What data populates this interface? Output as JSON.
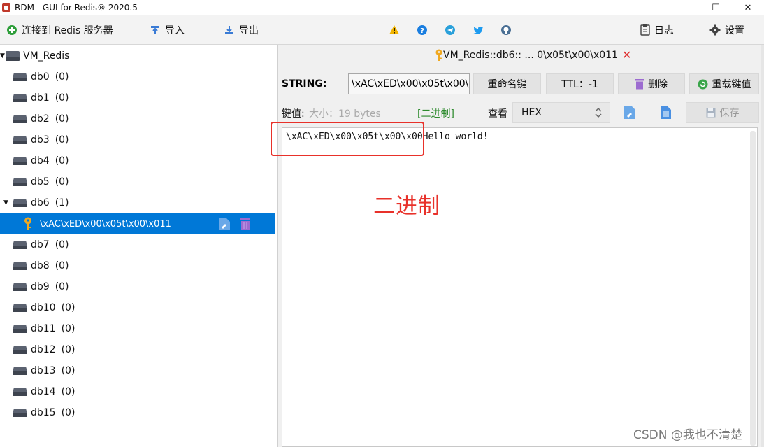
{
  "window": {
    "title": "RDM - GUI for Redis® 2020.5",
    "controls": {
      "minimize": "—",
      "maximize": "☐",
      "close": "✕"
    }
  },
  "toolbar": {
    "connect_label": "连接到 Redis 服务器",
    "import_label": "导入",
    "export_label": "导出",
    "log_label": "日志",
    "settings_label": "设置",
    "icons": [
      "warning-icon",
      "help-icon",
      "telegram-icon",
      "twitter-icon",
      "github-icon"
    ]
  },
  "tree": {
    "server": "VM_Redis",
    "databases": [
      {
        "name": "db0",
        "count": "(0)"
      },
      {
        "name": "db1",
        "count": "(0)"
      },
      {
        "name": "db2",
        "count": "(0)"
      },
      {
        "name": "db3",
        "count": "(0)"
      },
      {
        "name": "db4",
        "count": "(0)"
      },
      {
        "name": "db5",
        "count": "(0)"
      },
      {
        "name": "db6",
        "count": "(1)"
      },
      {
        "name": "db7",
        "count": "(0)"
      },
      {
        "name": "db8",
        "count": "(0)"
      },
      {
        "name": "db9",
        "count": "(0)"
      },
      {
        "name": "db10",
        "count": "(0)"
      },
      {
        "name": "db11",
        "count": "(0)"
      },
      {
        "name": "db12",
        "count": "(0)"
      },
      {
        "name": "db13",
        "count": "(0)"
      },
      {
        "name": "db14",
        "count": "(0)"
      },
      {
        "name": "db15",
        "count": "(0)"
      }
    ],
    "selected_key": "\\xAC\\xED\\x00\\x05t\\x00\\x011"
  },
  "tab": {
    "title": "VM_Redis::db6:: ... 0\\x05t\\x00\\x011",
    "close": "✕"
  },
  "key_editor": {
    "type_label": "STRING:",
    "key_name_value": "\\xAC\\xED\\x00\\x05t\\x00\\x011",
    "rename_label": "重命名键",
    "ttl_label": "TTL：-1",
    "delete_label": "删除",
    "reload_label": "重载键值",
    "value_label": "键值:",
    "size_label": "大小：19 bytes",
    "mode_label": "[二进制]",
    "view_label": "查看",
    "format_value": "HEX",
    "save_label": "保存",
    "value_text": "\\xAC\\xED\\x00\\x05t\\x00\\x00Hello world!"
  },
  "annotation": {
    "text": "二进制",
    "color": "#e8312a"
  },
  "watermark": "CSDN @我也不清楚",
  "colors": {
    "selection": "#0078d7",
    "binary_mode": "#2e8b2e",
    "close_red": "#e03030"
  }
}
